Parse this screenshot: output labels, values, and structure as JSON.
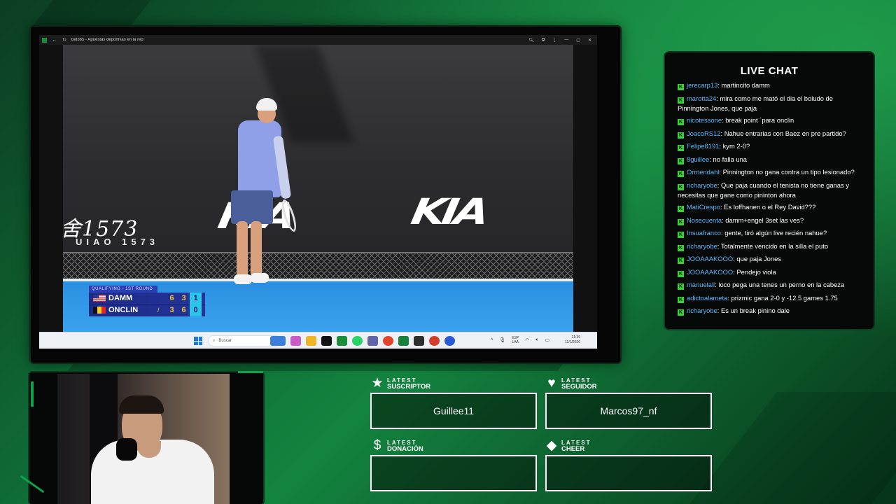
{
  "browser": {
    "title": "bet365 - Apuestas deportivas en la red"
  },
  "broadcast": {
    "brand_text": "舍1573",
    "brand_subtext": "UIAO 1573",
    "sponsor_left": "KIA",
    "sponsor_right": "KIA"
  },
  "scoreboard": {
    "round": "QUALIFYING - 1ST ROUND",
    "players": [
      {
        "name": "DAMM",
        "flag": "us",
        "sets": [
          "6",
          "3"
        ],
        "current": "1",
        "serving": false
      },
      {
        "name": "ONCLIN",
        "flag": "be",
        "sets": [
          "3",
          "6"
        ],
        "current": "0",
        "serving": true
      }
    ]
  },
  "taskbar": {
    "search_placeholder": "Buscar",
    "lang_line1": "ESP",
    "lang_line2": "LAA",
    "time": "21:39",
    "date": "11/1/2026"
  },
  "chat": {
    "title": "LIVE CHAT",
    "badge": "K",
    "messages": [
      {
        "user": "jerecarp13",
        "text": "martincito damm"
      },
      {
        "user": "marotta24",
        "text": "mira como me mató el dia el boludo de Pinnington Jones, que paja"
      },
      {
        "user": "nicotessone",
        "text": "break point ´para onclin"
      },
      {
        "user": "JoacoRS12",
        "text": "Nahue entrarias con Baez en pre partido?"
      },
      {
        "user": "Felipe8191",
        "text": "kym 2-0?"
      },
      {
        "user": "8guillee",
        "text": "no falla una"
      },
      {
        "user": "Ormendahl",
        "text": "Pinnington no gana contra un tipo lesionado?"
      },
      {
        "user": "richaryobe",
        "text": "Que paja cuando el tenista no tiene ganas y necesitas que gane como pininton ahora"
      },
      {
        "user": "MatiCrespo",
        "text": "Es loffhanen o el Rey David???"
      },
      {
        "user": "Nosecuenta",
        "text": "damm+engel 3set las ves?"
      },
      {
        "user": "Insuafranco",
        "text": "gente, tiró algún live recién nahue?"
      },
      {
        "user": "richaryobe",
        "text": "Totalmente vencido en la silla el puto"
      },
      {
        "user": "JOOAAAKOOO",
        "text": "que paja Jones"
      },
      {
        "user": "JOOAAAKOOO",
        "text": "Pendejo viola"
      },
      {
        "user": "manuelall",
        "text": "loco pega una tenes un perno en la cabeza"
      },
      {
        "user": "adictoalameta",
        "text": "prizmic gana 2-0 y -12.5 games 1.75"
      },
      {
        "user": "richaryobe",
        "text": "Es un break pinino dale"
      }
    ]
  },
  "latest": {
    "suscriptor": {
      "label1": "LATEST",
      "label2": "SUSCRIPTOR",
      "value": "Guillee11",
      "icon": "star-icon"
    },
    "seguidor": {
      "label1": "LATEST",
      "label2": "SEGUIDOR",
      "value": "Marcos97_nf",
      "icon": "heart-icon"
    },
    "donacion": {
      "label1": "LATEST",
      "label2": "DONACIÓN",
      "value": "",
      "icon": "dollar-icon"
    },
    "cheer": {
      "label1": "LATEST",
      "label2": "CHEER",
      "value": "",
      "icon": "diamond-icon"
    }
  },
  "colors": {
    "accent_green": "#13843f",
    "chat_user": "#58b8ff",
    "chat_badge": "#3bd13a"
  }
}
